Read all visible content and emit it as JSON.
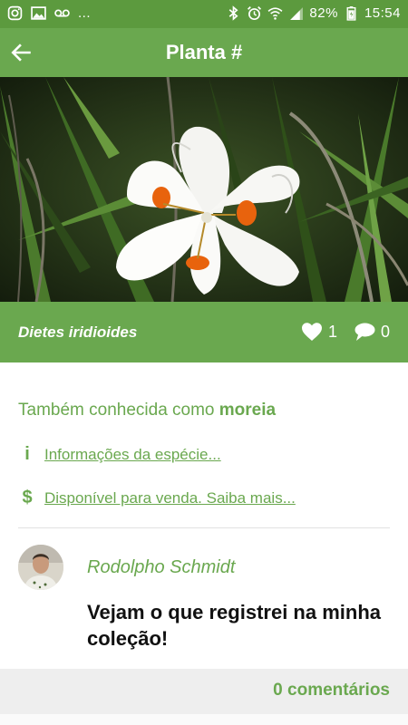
{
  "status_bar": {
    "left_icons": [
      "instagram-icon",
      "gallery-icon",
      "voicemail-icon"
    ],
    "overflow": "...",
    "right_icons": [
      "bluetooth-icon",
      "alarm-icon",
      "wifi-icon",
      "signal-icon"
    ],
    "battery_percent": "82%",
    "time": "15:54"
  },
  "app_bar": {
    "back_icon": "arrow-left-icon",
    "title": "Planta #"
  },
  "photo": {
    "subject": "white iris flower",
    "page_indicator_count": 1
  },
  "species_bar": {
    "scientific_name": "Dietes iridioides",
    "likes": "1",
    "comments": "0",
    "like_icon": "heart-icon",
    "comment_icon": "speech-bubble-icon"
  },
  "info": {
    "aka_prefix": "Também conhecida como",
    "aka_name": "moreia",
    "species_info_link": "Informações da espécie...",
    "for_sale_link": "Disponível para venda. Saiba mais...",
    "info_icon": "i",
    "sale_icon": "$"
  },
  "post": {
    "author": "Rodolpho Schmidt",
    "text": "Vejam o que registrei na minha coleção!"
  },
  "footer": {
    "comments_link": "0 comentários"
  },
  "colors": {
    "primary": "#6aa84f",
    "status_bar": "#5c9a3e",
    "petal_spot": "#e8630d"
  }
}
